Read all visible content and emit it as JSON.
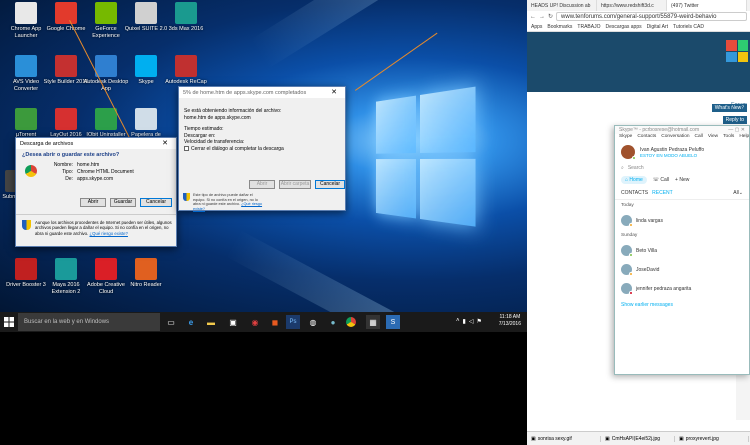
{
  "desktop": {
    "icons": [
      {
        "label": "Chrome App Launcher",
        "color": "#e8e8e8"
      },
      {
        "label": "Google Chrome",
        "color": "#e23a2c"
      },
      {
        "label": "GeForce Experience",
        "color": "#76b900"
      },
      {
        "label": "Quixel SUITE 2.0",
        "color": "#d0d0d0"
      },
      {
        "label": "3ds Max 2016",
        "color": "#1a9a8f"
      },
      {
        "label": "AVS Video Converter",
        "color": "#2a8fd8"
      },
      {
        "label": "Style Builder 2016",
        "color": "#c43030"
      },
      {
        "label": "Autodesk Desktop App",
        "color": "#2f7fd0"
      },
      {
        "label": "Skype",
        "color": "#00aff0"
      },
      {
        "label": "Autodesk ReCap",
        "color": "#c03030"
      },
      {
        "label": "µTorrent",
        "color": "#3c9a3c"
      },
      {
        "label": "LayOut 2016",
        "color": "#d63030"
      },
      {
        "label": "IObit Uninstaller",
        "color": "#2c9f4a"
      },
      {
        "label": "Papelera de",
        "color": "#d0dde8"
      },
      {
        "label": "Submit Cat",
        "color": "#444"
      },
      {
        "label": "Driver Booster 3",
        "color": "#c02020"
      },
      {
        "label": "Maya 2016 Extension 2",
        "color": "#1a9a9a"
      },
      {
        "label": "Adobe Creative Cloud",
        "color": "#da1f26"
      },
      {
        "label": "Nitro Reader",
        "color": "#e06020"
      }
    ]
  },
  "download_dialog": {
    "title": "Descarga de archivos",
    "question": "¿Desea abrir o guardar este archivo?",
    "name_label": "Nombre:",
    "name_value": "home.htm",
    "type_label": "Tipo:",
    "type_value": "Chrome HTML Document",
    "from_label": "De:",
    "from_value": "apps.skype.com",
    "open_btn": "Abrir",
    "save_btn": "Guardar",
    "cancel_btn": "Cancelar",
    "warning": "Aunque los archivos procedentes de Internet pueden ser útiles, algunos archivos pueden llegar a dañar el equipo. Si no confía en el origen, no abra ni guarde este archivo.",
    "warning_link": "¿Qué riesgo existe?"
  },
  "progress_dialog": {
    "title": "5% de home.htm de apps.skype.com completados",
    "obtaining": "Se está obteniendo información del archivo:",
    "file_from": "home.htm de apps.skype.com",
    "estimated": "Tiempo estimado:",
    "download_to": "Descargar en:",
    "speed": "Velocidad de transferencia:",
    "close_checkbox": "Cerrar el diálogo al completar la descarga",
    "btn_open": "Abrir",
    "btn_open_folder": "Abrir carpeta",
    "btn_cancel": "Cancelar",
    "warning": "Este tipo de archivo puede dañar el equipo. Si no confía en el origen, no lo abra ni guarde este archivo.",
    "warning_link": "¿Qué riesgo existe?"
  },
  "taskbar": {
    "search_placeholder": "Buscar en la web y en Windows",
    "time": "11:18 AM",
    "date": "7/13/2016"
  },
  "browser": {
    "tabs": [
      {
        "label": "HEADS UP! Discussion ab"
      },
      {
        "label": "https://www.redshift3d.c"
      },
      {
        "label": "(497) Twitter"
      }
    ],
    "url": "www.tenforums.com/general-support/55879-weird-behavio",
    "bookmarks": [
      "Apps",
      "Bookmarks",
      "TRABAJO",
      "Descargas apps",
      "Digital Art",
      "Tutoriels CAD"
    ],
    "whats_new": "What's New?",
    "forum_link": "Forum",
    "reply_btn": "Reply to",
    "downloads": [
      {
        "label": "sonrisa sexy.gif"
      },
      {
        "label": "CmHsAPI(E4ei52j.jpg"
      },
      {
        "label": "proxyrevert.jpg"
      }
    ]
  },
  "skype": {
    "title": "Skype™ - pcrbosrese@hotmail.com",
    "menu": [
      "Skype",
      "Contacts",
      "Conversation",
      "Call",
      "View",
      "Tools",
      "Help"
    ],
    "user_name": "Ivan Agustin Pedraza Peluffo",
    "status": "ESTOY EN MODO ABUELO",
    "search": "Search",
    "home": "Home",
    "call": "Call",
    "new": "New",
    "contacts_tab": "CONTACTS",
    "recent_tab": "RECENT",
    "filter": "All",
    "groups": [
      {
        "heading": "Today",
        "contacts": [
          {
            "name": "linda vargas",
            "status_color": "#f5a623"
          }
        ]
      },
      {
        "heading": "Sunday",
        "contacts": [
          {
            "name": "Beto  Villa",
            "status_color": "#7ac143"
          },
          {
            "name": "JoseDavid",
            "status_color": "#f5a623"
          },
          {
            "name": "jennifer pedraza angarita",
            "status_color": "#d0021b"
          }
        ]
      }
    ],
    "show_more": "Show earlier messages"
  }
}
